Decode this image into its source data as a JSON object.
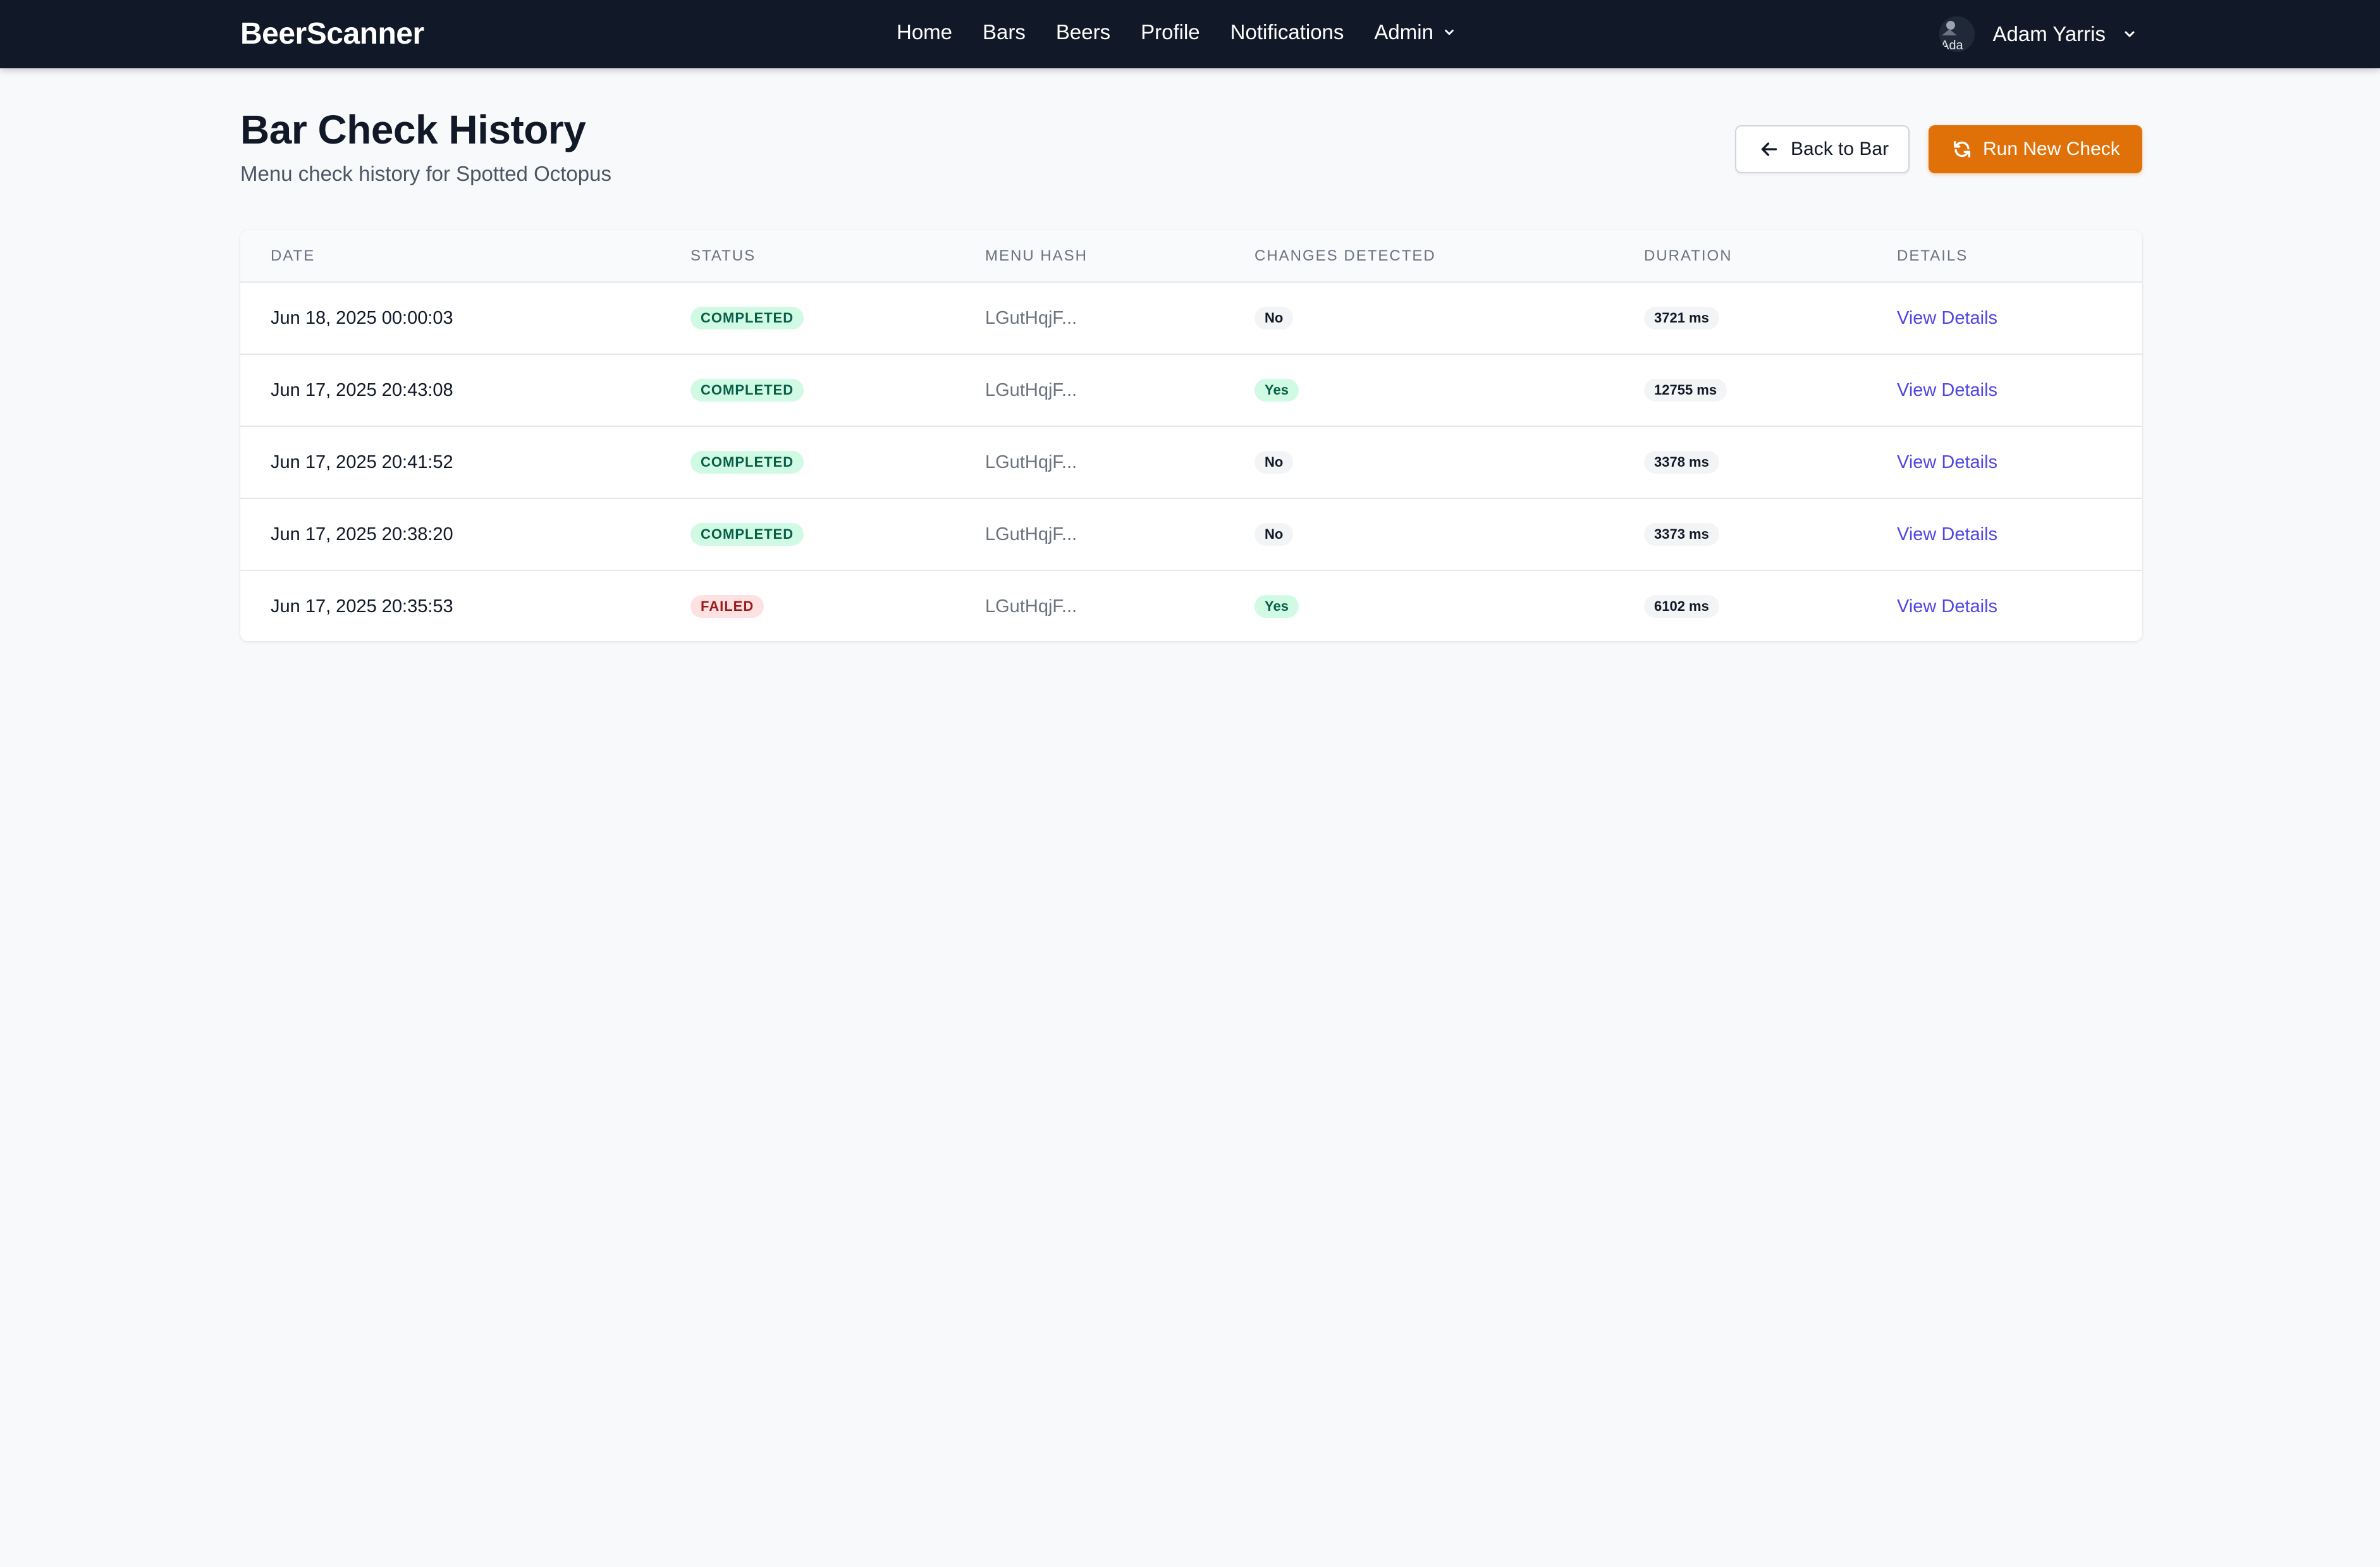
{
  "nav": {
    "brand": "BeerScanner",
    "links": [
      "Home",
      "Bars",
      "Beers",
      "Profile",
      "Notifications",
      "Admin"
    ],
    "user_name": "Adam Yarris",
    "avatar_alt": "Ada"
  },
  "header": {
    "title": "Bar Check History",
    "subtitle": "Menu check history for Spotted Octopus",
    "back_label": "Back to Bar",
    "run_label": "Run New Check"
  },
  "table": {
    "columns": [
      "Date",
      "Status",
      "Menu Hash",
      "Changes Detected",
      "Duration",
      "Details"
    ],
    "rows": [
      {
        "date": "Jun 18, 2025 00:00:03",
        "status": "COMPLETED",
        "hash": "LGutHqjF...",
        "changes": "No",
        "duration": "3721 ms",
        "details": "View Details"
      },
      {
        "date": "Jun 17, 2025 20:43:08",
        "status": "COMPLETED",
        "hash": "LGutHqjF...",
        "changes": "Yes",
        "duration": "12755 ms",
        "details": "View Details"
      },
      {
        "date": "Jun 17, 2025 20:41:52",
        "status": "COMPLETED",
        "hash": "LGutHqjF...",
        "changes": "No",
        "duration": "3378 ms",
        "details": "View Details"
      },
      {
        "date": "Jun 17, 2025 20:38:20",
        "status": "COMPLETED",
        "hash": "LGutHqjF...",
        "changes": "No",
        "duration": "3373 ms",
        "details": "View Details"
      },
      {
        "date": "Jun 17, 2025 20:35:53",
        "status": "FAILED",
        "hash": "LGutHqjF...",
        "changes": "Yes",
        "duration": "6102 ms",
        "details": "View Details"
      }
    ]
  },
  "colors": {
    "nav_bg": "#111827",
    "accent": "#e07109",
    "link": "#4f46e5",
    "success_bg": "#d1fae5",
    "success_fg": "#065f46",
    "fail_bg": "#fee2e2",
    "fail_fg": "#991b1b"
  }
}
